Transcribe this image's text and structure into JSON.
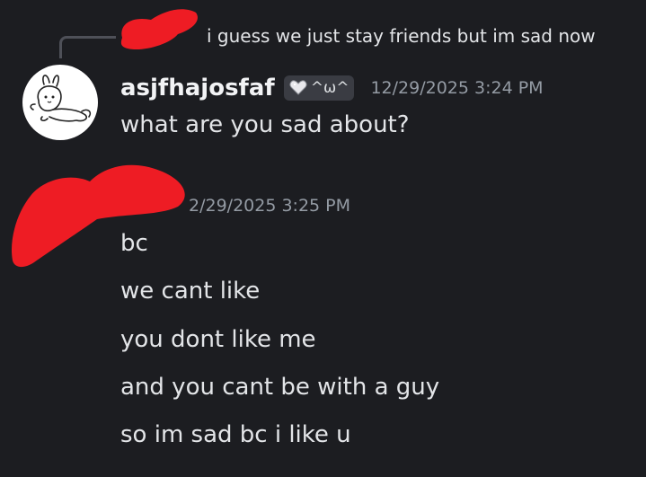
{
  "reply": {
    "text": "i guess we just stay friends but im sad now"
  },
  "message1": {
    "username": "asjfhajosfaf",
    "clan_tag": "^ω^",
    "timestamp": "12/29/2025 3:24 PM",
    "text": "what are you sad about?"
  },
  "message2": {
    "timestamp": "2/29/2025 3:25 PM",
    "lines": [
      "bc",
      "we cant like",
      "you dont like me",
      "and you cant be with a guy",
      "so im sad bc i like u"
    ]
  },
  "colors": {
    "background": "#1c1d21",
    "text": "#e3e5e8",
    "muted": "#949ba4",
    "redaction": "#ee1c24"
  }
}
